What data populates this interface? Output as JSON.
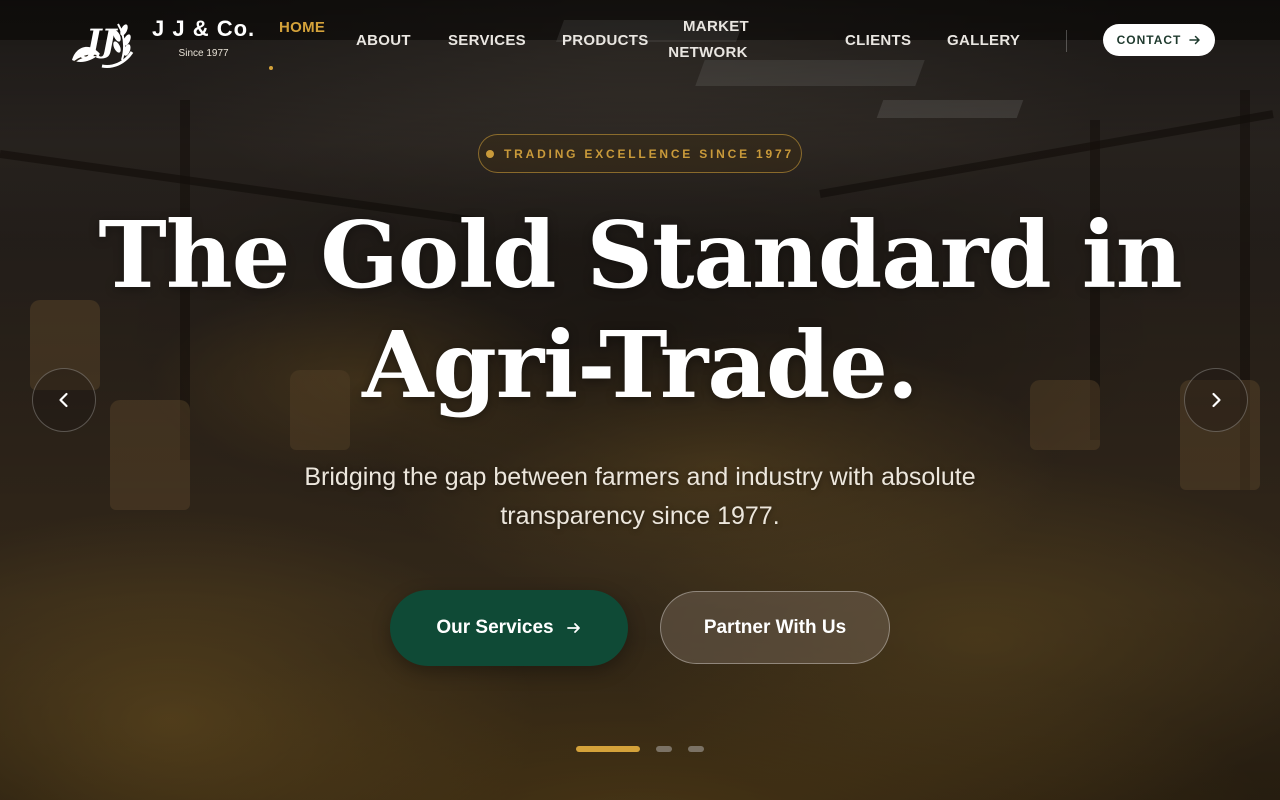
{
  "brand": {
    "name": "J J & Co.",
    "since": "Since 1977"
  },
  "nav": {
    "home": "HOME",
    "about": "ABOUT",
    "services": "SERVICES",
    "products": "PRODUCTS",
    "market_line1": "MARKET",
    "market_line2": "NETWORK",
    "clients": "CLIENTS",
    "gallery": "GALLERY",
    "contact": "CONTACT"
  },
  "hero": {
    "badge": "TRADING EXCELLENCE SINCE 1977",
    "headline_line1": "The Gold Standard in",
    "headline_line2": "Agri-Trade.",
    "subtitle": "Bridging the gap between farmers and industry with absolute transparency since 1977.",
    "primary_cta": "Our Services",
    "secondary_cta": "Partner With Us"
  },
  "slider": {
    "slide_count": 3,
    "active_index": 0
  },
  "colors": {
    "accent_gold": "#d4a23a",
    "primary_green": "#0f4a36",
    "contact_text": "#1f3a2e"
  },
  "icons": {
    "contact_arrow": "arrow-right-icon",
    "primary_arrow": "arrow-right-icon",
    "prev": "chevron-left-icon",
    "next": "chevron-right-icon",
    "logo": "wheat-leaf-logo"
  }
}
